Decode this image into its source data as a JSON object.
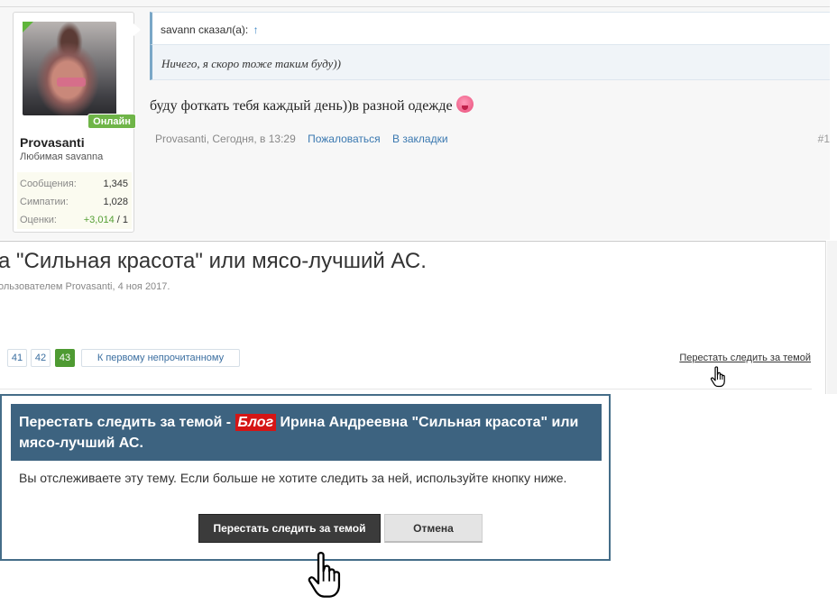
{
  "post": {
    "user": {
      "name": "Provasanti",
      "title": "Любимая savanna",
      "online_badge": "Онлайн",
      "stats": [
        {
          "label": "Сообщения:",
          "value": "1,345"
        },
        {
          "label": "Симпатии:",
          "value": "1,028"
        },
        {
          "label": "Оценки:",
          "value_positive": "+3,014",
          "value_rest": " / 1"
        }
      ]
    },
    "quote": {
      "author_line": "savann сказал(а):",
      "arrow": "↑",
      "text": "Ничего, я скоро тоже таким буду))"
    },
    "message": "буду фоткать тебя каждый день))в разной одежде",
    "meta": {
      "author_time": "Provasanti, Сегодня, в 13:29",
      "report_link": "Пожаловаться",
      "bookmark_link": "В закладки",
      "post_number": "#1"
    }
  },
  "thread": {
    "title": "а \"Сильная красота\" или мясо-лучший АС.",
    "subtitle": "ользователем Provasanti, 4 ноя 2017.",
    "pages": [
      "41",
      "42",
      "43"
    ],
    "current_page": "43",
    "first_unread_label": "К первому непрочитанному",
    "unwatch_link": "Перестать следить за темой"
  },
  "dialog": {
    "title_prefix": "Перестать следить за темой - ",
    "blog_tag": "Блог",
    "title_rest": " Ирина Андреевна \"Сильная красота\" или мясо-лучший АС.",
    "body": "Вы отслеживаете эту тему. Если больше не хотите следить за ней, используйте кнопку ниже.",
    "confirm_button": "Перестать следить за темой",
    "cancel_button": "Отмена"
  },
  "colors": {
    "online": "#6fb548",
    "current_page": "#4e9a32",
    "dialog_header": "#3d6380",
    "blog_tag": "#d51515",
    "link": "#3a78b0"
  },
  "icons": [
    "hand-pointer-icon",
    "smiley-tongue-icon",
    "arrow-up-icon"
  ]
}
